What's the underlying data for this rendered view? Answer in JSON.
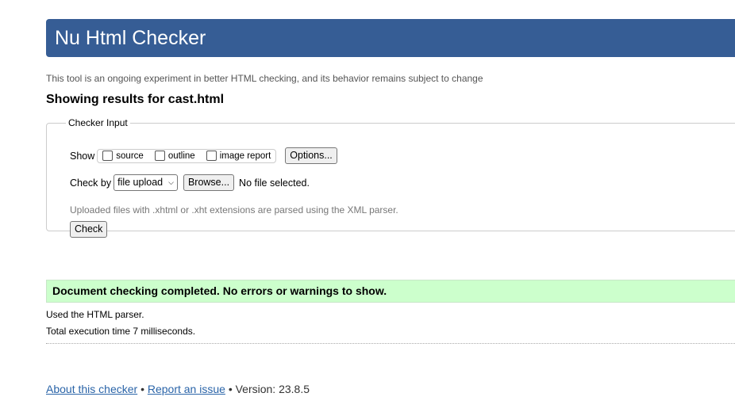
{
  "header": {
    "title": "Nu Html Checker"
  },
  "tagline": "This tool is an ongoing experiment in better HTML checking, and its behavior remains subject to change",
  "results_heading": "Showing results for cast.html",
  "checker_input": {
    "legend": "Checker Input",
    "show_label": "Show",
    "show_options": [
      {
        "label": "source",
        "checked": false
      },
      {
        "label": "outline",
        "checked": false
      },
      {
        "label": "image report",
        "checked": false
      }
    ],
    "options_button": "Options...",
    "check_by_label": "Check by",
    "check_by_selected": "file upload",
    "browse_button": "Browse...",
    "file_status": "No file selected.",
    "hint": "Uploaded files with .xhtml or .xht extensions are parsed using the XML parser.",
    "check_button": "Check"
  },
  "result": {
    "message": "Document checking completed. No errors or warnings to show.",
    "parser_info": "Used the HTML parser.",
    "time_info": "Total execution time 7 milliseconds."
  },
  "footer": {
    "about_link": "About this checker",
    "separator": "•",
    "report_link": "Report an issue",
    "version": "• Version: 23.8.5"
  },
  "colors": {
    "header_bg": "#365d95",
    "success_bg": "#ccffcc",
    "link": "#2a64a8"
  }
}
